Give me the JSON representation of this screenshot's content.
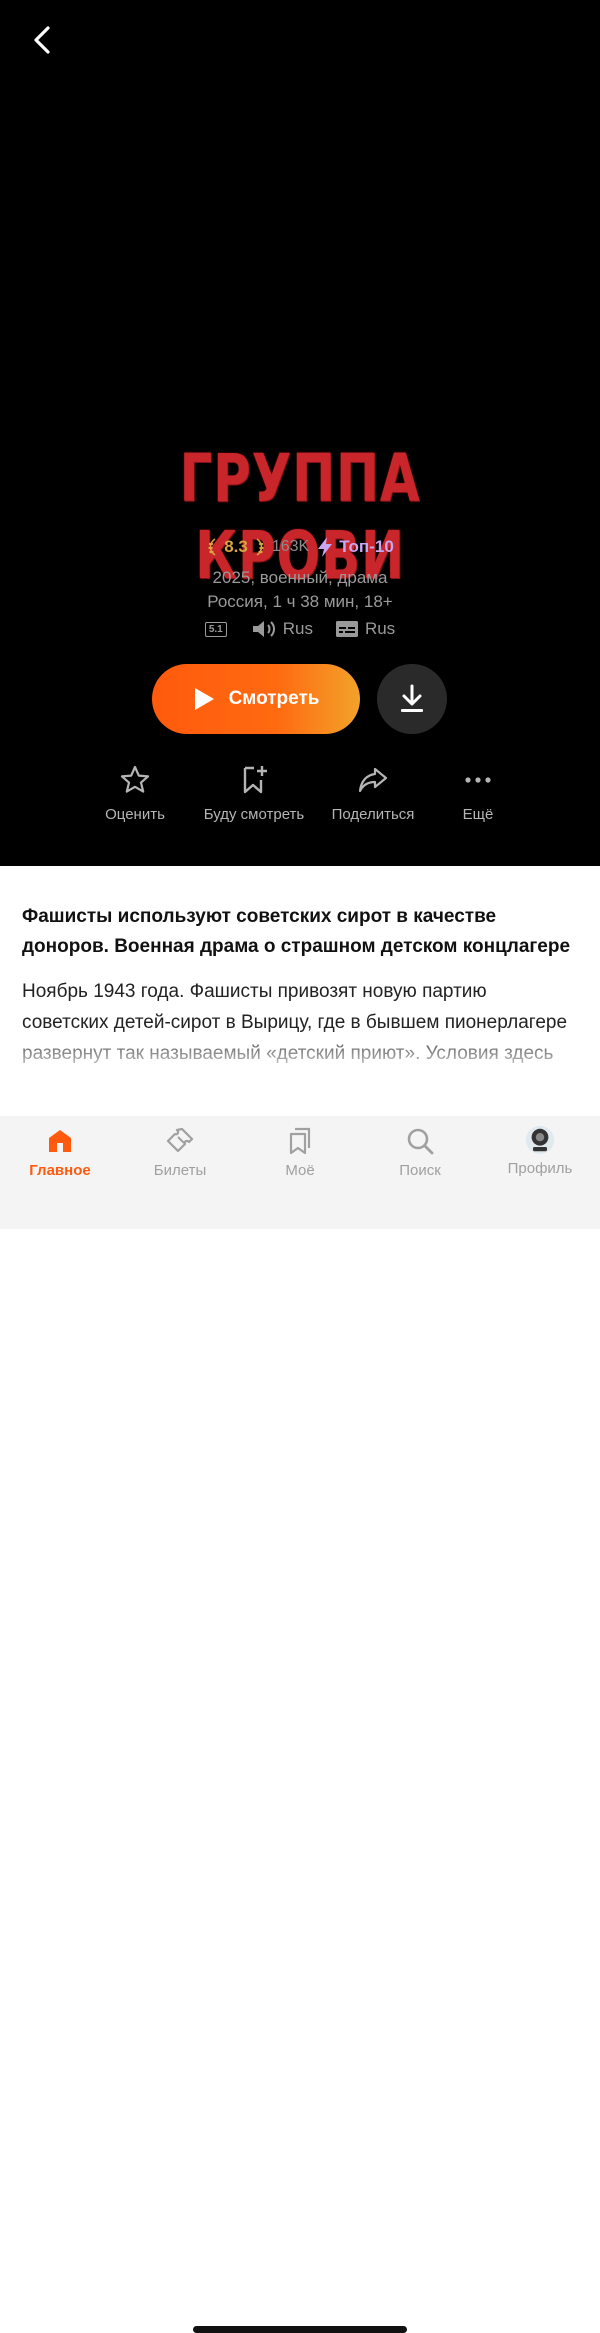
{
  "movie": {
    "title": "ГРУППА КРОВИ",
    "rating": "8.3",
    "votes": "163K",
    "top_badge": "Топ-10",
    "info_line1": "2025, военный, драма",
    "info_line2": "Россия, 1 ч 38 мин, 18+",
    "audio_format": "5.1",
    "audio_lang": "Rus",
    "subtitles_lang": "Rus"
  },
  "buttons": {
    "watch": "Смотреть"
  },
  "actions": [
    {
      "label": "Оценить",
      "icon": "star-icon"
    },
    {
      "label": "Буду смотреть",
      "icon": "bookmark-plus-icon"
    },
    {
      "label": "Поделиться",
      "icon": "share-icon"
    },
    {
      "label": "Ещё",
      "icon": "more-icon"
    }
  ],
  "description": {
    "title": "Фашисты используют советских сирот в качестве доноров. Военная драма о страшном детском концлагере",
    "body": "Ноябрь 1943 года. Фашисты привозят новую партию советских детей-сирот в Вырицу, где в бывшем пионерлагере развернут так называемый «детский приют». Условия здесь невыносимые: холод, голод"
  },
  "tabs": [
    {
      "label": "Главное",
      "icon": "home-icon",
      "active": true
    },
    {
      "label": "Билеты",
      "icon": "ticket-icon"
    },
    {
      "label": "Моё",
      "icon": "my-bookmarks-icon"
    },
    {
      "label": "Поиск",
      "icon": "search-icon"
    },
    {
      "label": "Профиль",
      "icon": "avatar"
    }
  ],
  "colors": {
    "accent": "#ff5a0d",
    "rating": "#d9a441",
    "top_badge": "#c7a6f2",
    "title_red": "#c8262a"
  }
}
